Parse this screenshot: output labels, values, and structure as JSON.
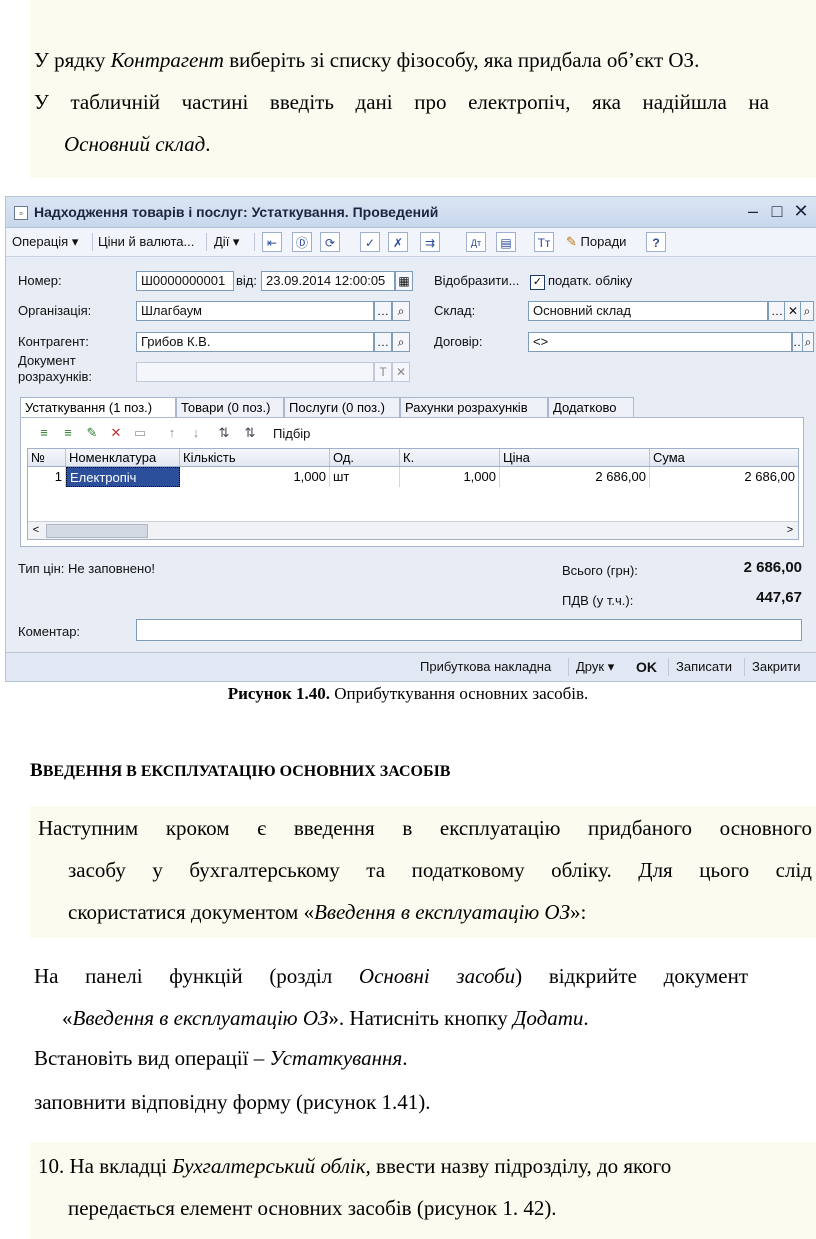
{
  "intro": {
    "line1_a": "У рядку ",
    "line1_b": "Контрагент",
    "line1_c": " виберіть зі списку фізособу, яка придбала об’єкт ОЗ.",
    "line2": "У табличній частині введіть дані про електропіч, яка надійшла на",
    "line3_a": "Основний склад",
    "line3_b": "."
  },
  "window": {
    "title": "Надходження товарів і послуг: Устаткування. Проведений",
    "toolbar": {
      "operation": "Операція ▾",
      "prices": "Ціни й валюта...",
      "actions": "Дії ▾",
      "tips": "Поради"
    },
    "form": {
      "number_label": "Номер:",
      "number": "Ш0000000001",
      "from_label": "від:",
      "date": "23.09.2014 12:00:05",
      "show_label": "Відобразити...",
      "tax_label": "податк. обліку",
      "org_label": "Організація:",
      "org": "Шлагбаум",
      "warehouse_label": "Склад:",
      "warehouse": "Основний склад",
      "contractor_label": "Контрагент:",
      "contractor": "Грибов К.В.",
      "contract_label": "Договір:",
      "contract": "<>",
      "settlement_label_1": "Документ",
      "settlement_label_2": "розрахунків:"
    },
    "tabs": [
      "Устаткування (1 поз.)",
      "Товари (0 поз.)",
      "Послуги (0 поз.)",
      "Рахунки розрахунків",
      "Додатково"
    ],
    "selection": "Підбір",
    "table": {
      "headers": [
        "№",
        "Номенклатура",
        "Кількість",
        "Од.",
        "К.",
        "Ціна",
        "Сума"
      ],
      "rows": [
        [
          "1",
          "Електропіч",
          "1,000",
          "шт",
          "1,000",
          "2 686,00",
          "2 686,00"
        ]
      ]
    },
    "price_type": "Тип цін: Не заповнено!",
    "total_label": "Всього (грн):",
    "total": "2 686,00",
    "vat_label": "ПДВ (у т.ч.):",
    "vat": "447,67",
    "comment_label": "Коментар:",
    "footer": {
      "receipt": "Прибуткова накладна",
      "print": "Друк ▾",
      "ok": "OK",
      "save": "Записати",
      "close": "Закрити"
    }
  },
  "caption": {
    "bold": "Рисунок 1.40.",
    "text": " Оприбуткування основних засобів."
  },
  "heading": {
    "big": "В",
    "rest": "ВЕДЕННЯ В ЕКСПЛУАТАЦІЮ ОСНОВНИХ ЗАСОБІВ"
  },
  "para1": {
    "line1": "Наступним кроком є введення в експлуатацію придбаного основного",
    "line2": "засобу у бухгалтерському та податковому обліку. Для цього слід",
    "line3_a": "скористатися документом «",
    "line3_b": "Введення в експлуатацію ОЗ",
    "line3_c": "»:"
  },
  "para2": {
    "l1_a": "На панелі функцій (розділ ",
    "l1_b": "Основні засоби",
    "l1_c": ") відкрийте документ",
    "l2_a": "«",
    "l2_b": "Введення в експлуатацію ОЗ",
    "l2_c": "». Натисніть кнопку ",
    "l2_d": "Додати",
    "l2_e": ".",
    "l3_a": "Встановіть вид операції – ",
    "l3_b": "Устаткування",
    "l3_c": ".",
    "l4": "заповнити відповідну форму (рисунок 1.41)."
  },
  "para3": {
    "a": "10. На вкладці ",
    "b": "Бухгалтерський облік,",
    "c": " ввести назву підрозділу, до якого",
    "d": "передається елемент основних засобів (рисунок 1. 42)."
  }
}
